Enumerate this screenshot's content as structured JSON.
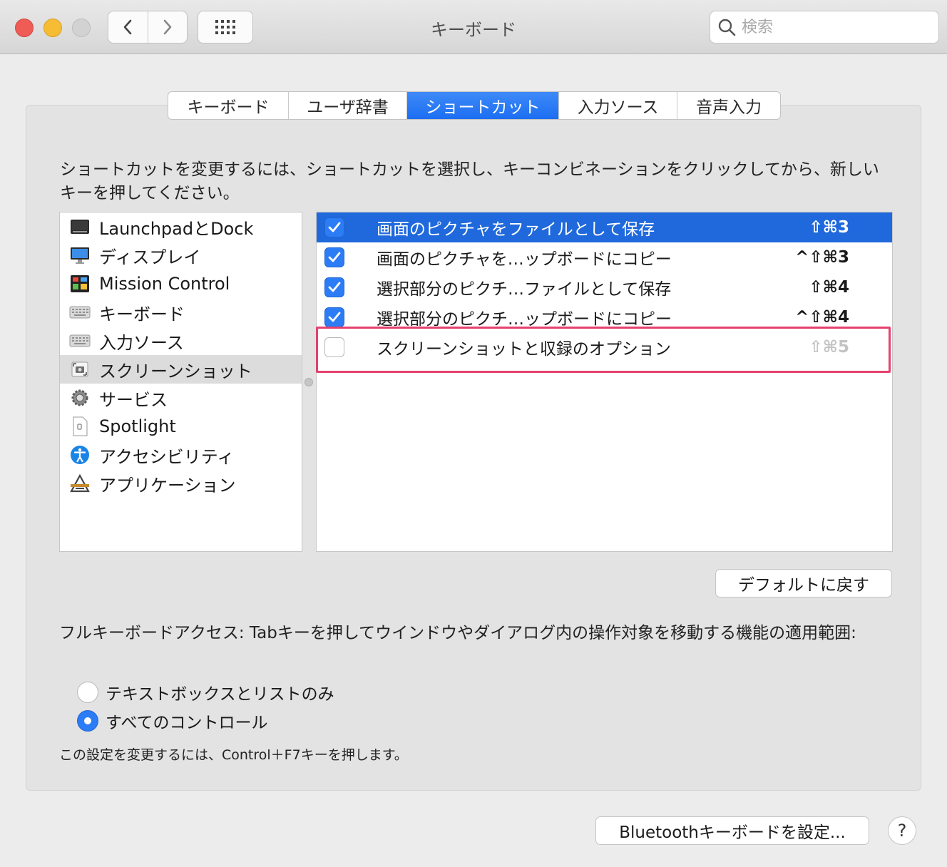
{
  "window": {
    "title": "キーボード",
    "search_placeholder": "検索"
  },
  "tabs": [
    {
      "label": "キーボード",
      "active": false
    },
    {
      "label": "ユーザ辞書",
      "active": false
    },
    {
      "label": "ショートカット",
      "active": true
    },
    {
      "label": "入力ソース",
      "active": false
    },
    {
      "label": "音声入力",
      "active": false
    }
  ],
  "description": "ショートカットを変更するには、ショートカットを選択し、キーコンビネーションをクリックしてから、新しいキーを押してください。",
  "categories": [
    {
      "label": "LaunchpadとDock",
      "icon": "launchpad-dock-icon",
      "selected": false
    },
    {
      "label": "ディスプレイ",
      "icon": "display-icon",
      "selected": false
    },
    {
      "label": "Mission Control",
      "icon": "mission-control-icon",
      "selected": false
    },
    {
      "label": "キーボード",
      "icon": "keyboard-icon",
      "selected": false
    },
    {
      "label": "入力ソース",
      "icon": "input-source-icon",
      "selected": false
    },
    {
      "label": "スクリーンショット",
      "icon": "screenshot-icon",
      "selected": true
    },
    {
      "label": "サービス",
      "icon": "services-gear-icon",
      "selected": false
    },
    {
      "label": "Spotlight",
      "icon": "spotlight-icon",
      "selected": false
    },
    {
      "label": "アクセシビリティ",
      "icon": "accessibility-icon",
      "selected": false
    },
    {
      "label": "アプリケーション",
      "icon": "applications-icon",
      "selected": false
    }
  ],
  "shortcuts": [
    {
      "label": "画面のピクチャをファイルとして保存",
      "keys": "⇧⌘3",
      "checked": true,
      "selected": true
    },
    {
      "label": "画面のピクチャを…ップボードにコピー",
      "keys": "^⇧⌘3",
      "checked": true,
      "selected": false
    },
    {
      "label": "選択部分のピクチ…ファイルとして保存",
      "keys": "⇧⌘4",
      "checked": true,
      "selected": false
    },
    {
      "label": "選択部分のピクチ…ップボードにコピー",
      "keys": "^⇧⌘4",
      "checked": true,
      "selected": false
    },
    {
      "label": "スクリーンショットと収録のオプション",
      "keys": "⇧⌘5",
      "checked": false,
      "selected": false
    }
  ],
  "restore_defaults_label": "デフォルトに戻す",
  "full_keyboard_access": {
    "text": "フルキーボードアクセス: Tabキーを押してウインドウやダイアログ内の操作対象を移動する機能の適用範囲:",
    "options": [
      {
        "label": "テキストボックスとリストのみ",
        "selected": false
      },
      {
        "label": "すべてのコントロール",
        "selected": true
      }
    ],
    "note": "この設定を変更するには、Control＋F7キーを押します。"
  },
  "bluetooth_button_label": "Bluetoothキーボードを設定...",
  "help_label": "?",
  "colors": {
    "accent": "#1f69dc",
    "highlight_box": "#e5416f",
    "close": "#ee5c55",
    "minimize": "#f6bc33"
  }
}
